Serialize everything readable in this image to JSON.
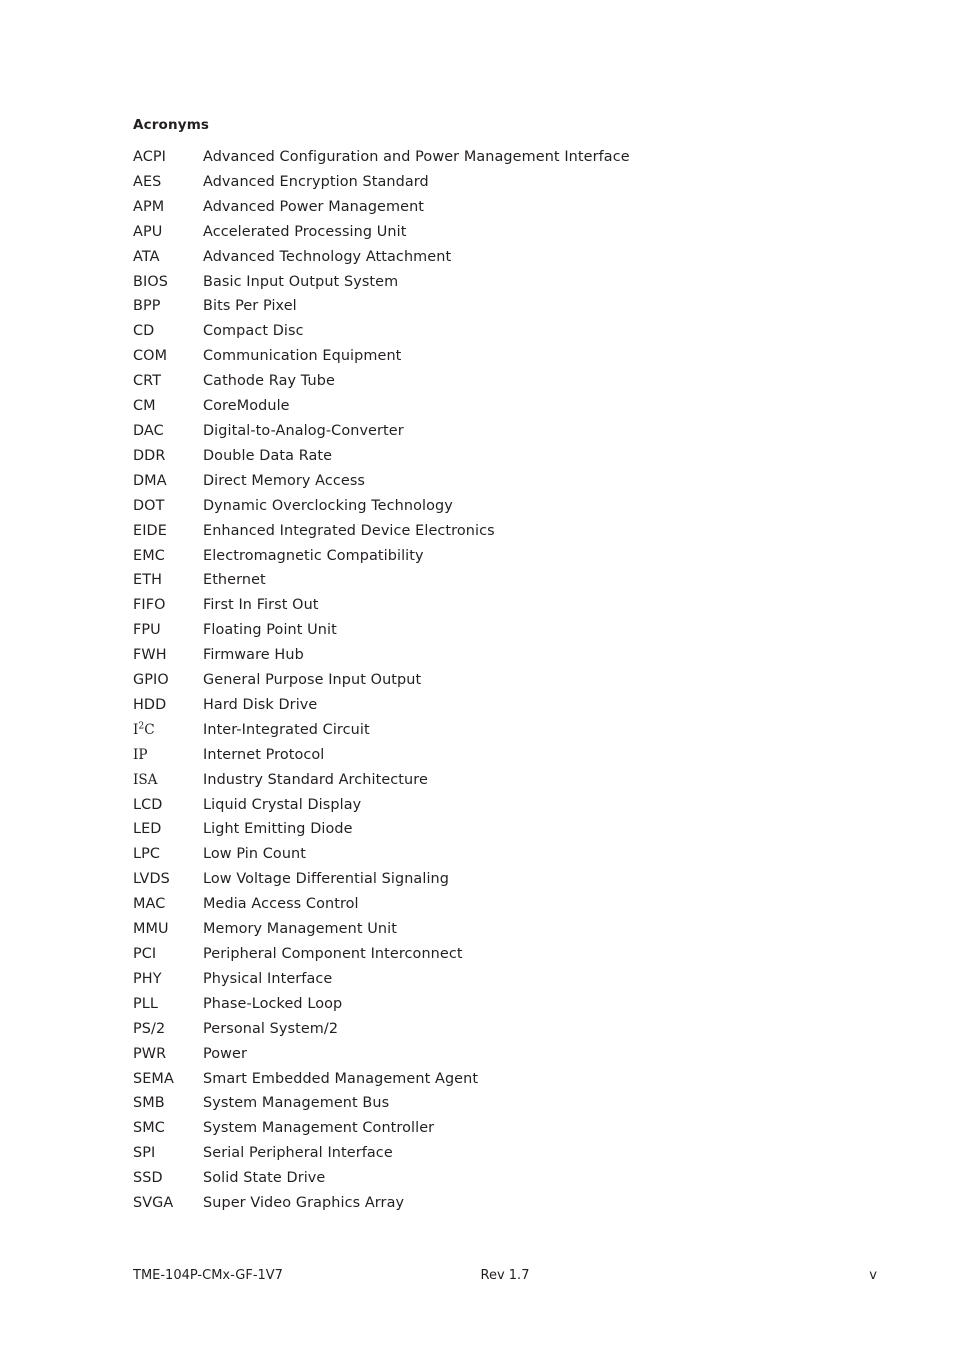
{
  "section": {
    "heading": "Acronyms"
  },
  "acronyms": [
    {
      "term": "ACPI",
      "serif": false,
      "definition": "Advanced Configuration and Power Management Interface"
    },
    {
      "term": "AES",
      "serif": false,
      "definition": "Advanced Encryption Standard"
    },
    {
      "term": "APM",
      "serif": false,
      "definition": "Advanced Power Management"
    },
    {
      "term": "APU",
      "serif": false,
      "definition": "Accelerated Processing Unit"
    },
    {
      "term": "ATA",
      "serif": false,
      "definition": "Advanced Technology Attachment"
    },
    {
      "term": "BIOS",
      "serif": false,
      "definition": "Basic Input Output System"
    },
    {
      "term": "BPP",
      "serif": false,
      "definition": "Bits Per Pixel"
    },
    {
      "term": "CD",
      "serif": false,
      "definition": "Compact Disc"
    },
    {
      "term": "COM",
      "serif": false,
      "definition": "Communication Equipment"
    },
    {
      "term": "CRT",
      "serif": false,
      "definition": "Cathode Ray Tube"
    },
    {
      "term": "CM",
      "serif": false,
      "definition": "CoreModule"
    },
    {
      "term": "DAC",
      "serif": false,
      "definition": "Digital-to-Analog-Converter"
    },
    {
      "term": "DDR",
      "serif": false,
      "definition": "Double Data Rate"
    },
    {
      "term": "DMA",
      "serif": false,
      "definition": "Direct Memory Access"
    },
    {
      "term": "DOT",
      "serif": false,
      "definition": "Dynamic Overclocking Technology"
    },
    {
      "term": "EIDE",
      "serif": false,
      "definition": "Enhanced Integrated Device Electronics"
    },
    {
      "term": "EMC",
      "serif": false,
      "definition": "Electromagnetic Compatibility"
    },
    {
      "term": "ETH",
      "serif": false,
      "definition": "Ethernet"
    },
    {
      "term": "FIFO",
      "serif": false,
      "definition": "First In First Out"
    },
    {
      "term": "FPU",
      "serif": false,
      "definition": "Floating Point Unit"
    },
    {
      "term": "FWH",
      "serif": false,
      "definition": "Firmware Hub"
    },
    {
      "term": "GPIO",
      "serif": false,
      "definition": "General Purpose Input Output"
    },
    {
      "term": "HDD",
      "serif": false,
      "definition": "Hard Disk Drive"
    },
    {
      "term": "I²C",
      "serif": true,
      "definition": "Inter-Integrated Circuit"
    },
    {
      "term": "IP",
      "serif": true,
      "definition": "Internet Protocol"
    },
    {
      "term": "ISA",
      "serif": true,
      "definition": "Industry Standard Architecture"
    },
    {
      "term": "LCD",
      "serif": false,
      "definition": "Liquid Crystal Display"
    },
    {
      "term": "LED",
      "serif": false,
      "definition": "Light Emitting Diode"
    },
    {
      "term": "LPC",
      "serif": false,
      "definition": "Low Pin Count"
    },
    {
      "term": "LVDS",
      "serif": false,
      "definition": "Low Voltage Differential Signaling"
    },
    {
      "term": "MAC",
      "serif": false,
      "definition": "Media Access Control"
    },
    {
      "term": "MMU",
      "serif": false,
      "definition": "Memory Management Unit"
    },
    {
      "term": "PCI",
      "serif": false,
      "definition": "Peripheral Component Interconnect"
    },
    {
      "term": "PHY",
      "serif": false,
      "definition": "Physical Interface"
    },
    {
      "term": "PLL",
      "serif": false,
      "definition": "Phase-Locked Loop"
    },
    {
      "term": "PS/2",
      "serif": false,
      "definition": "Personal System/2"
    },
    {
      "term": "PWR",
      "serif": false,
      "definition": "Power"
    },
    {
      "term": "SEMA",
      "serif": false,
      "definition": "Smart Embedded Management Agent"
    },
    {
      "term": "SMB",
      "serif": false,
      "definition": "System Management Bus"
    },
    {
      "term": "SMC",
      "serif": false,
      "definition": "System Management Controller"
    },
    {
      "term": "SPI",
      "serif": false,
      "definition": "Serial Peripheral Interface"
    },
    {
      "term": "SSD",
      "serif": false,
      "definition": "Solid State Drive"
    },
    {
      "term": "SVGA",
      "serif": false,
      "definition": "Super Video Graphics Array"
    }
  ],
  "footer": {
    "document_id": "TME-104P-CMx-GF-1V7",
    "revision": "Rev 1.7",
    "page_number": "v"
  }
}
